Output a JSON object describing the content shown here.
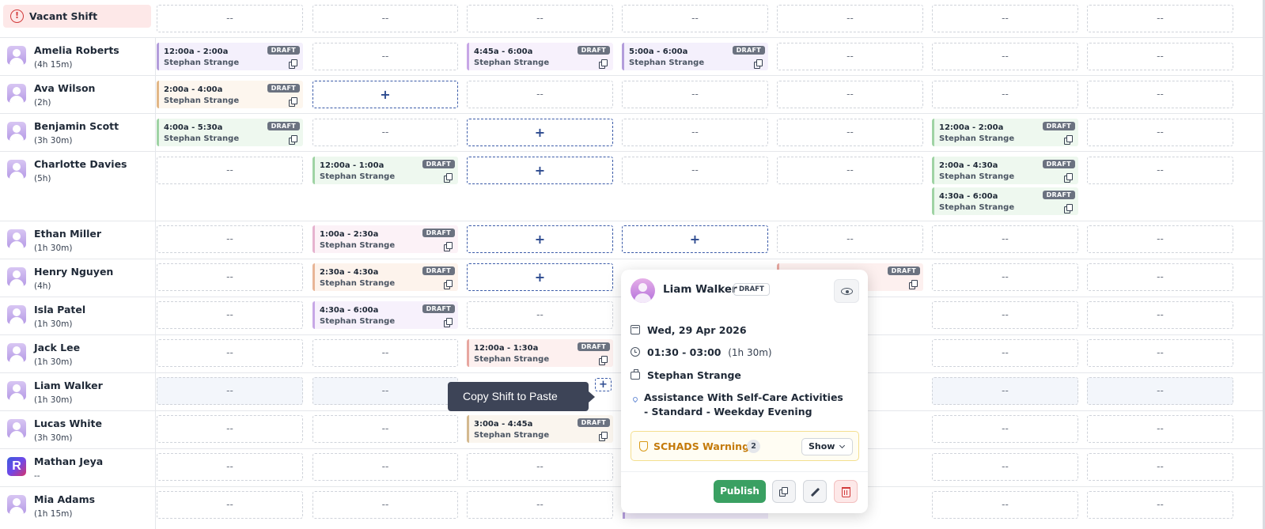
{
  "vacant": {
    "label": "Vacant Shift",
    "empty": [
      "--",
      "--",
      "--",
      "--",
      "--",
      "--",
      "--"
    ]
  },
  "employees": [
    {
      "name": "Amelia Roberts",
      "hours": "(4h 15m)"
    },
    {
      "name": "Ava Wilson",
      "hours": "(2h)"
    },
    {
      "name": "Benjamin Scott",
      "hours": "(3h 30m)"
    },
    {
      "name": "Charlotte Davies",
      "hours": "(5h)"
    },
    {
      "name": "Ethan Miller",
      "hours": "(1h 30m)"
    },
    {
      "name": "Henry Nguyen",
      "hours": "(4h)"
    },
    {
      "name": "Isla Patel",
      "hours": "(1h 30m)"
    },
    {
      "name": "Jack Lee",
      "hours": "(1h 30m)"
    },
    {
      "name": "Liam Walker",
      "hours": "(1h 30m)"
    },
    {
      "name": "Lucas White",
      "hours": "(3h 30m)"
    },
    {
      "name": "Mathan Jeya",
      "hours": "--",
      "initial": "R"
    },
    {
      "name": "Mia Adams",
      "hours": "(1h 15m)"
    }
  ],
  "placeholders": {
    "empty": "--",
    "add": "+"
  },
  "shifts": [
    {
      "time": "12:00a - 2:00a",
      "worker": "Stephan Strange",
      "status": "DRAFT"
    },
    {
      "time": "4:45a - 6:00a",
      "worker": "Stephan Strange",
      "status": "DRAFT"
    },
    {
      "time": "5:00a - 6:00a",
      "worker": "Stephan Strange",
      "status": "DRAFT"
    },
    {
      "time": "2:00a - 4:00a",
      "worker": "Stephan Strange",
      "status": "DRAFT"
    },
    {
      "time": "4:00a - 5:30a",
      "worker": "Stephan Strange",
      "status": "DRAFT"
    },
    {
      "time": "12:00a - 2:00a",
      "worker": "Stephan Strange",
      "status": "DRAFT"
    },
    {
      "time": "12:00a - 1:00a",
      "worker": "Stephan Strange",
      "status": "DRAFT"
    },
    {
      "time": "2:00a - 4:30a",
      "worker": "Stephan Strange",
      "status": "DRAFT"
    },
    {
      "time": "4:30a - 6:00a",
      "worker": "Stephan Strange",
      "status": "DRAFT"
    },
    {
      "time": "1:00a - 2:30a",
      "worker": "Stephan Strange",
      "status": "DRAFT"
    },
    {
      "time": "2:30a - 4:30a",
      "worker": "Stephan Strange",
      "status": "DRAFT"
    },
    {
      "time": "4:30a - 6:00a",
      "worker": "Stephan Strange",
      "status": "DRAFT"
    },
    {
      "time": "12:00a - 1:30a",
      "worker": "Stephan Strange",
      "status": "DRAFT"
    },
    {
      "time": "3:00a - 4:45a",
      "worker": "Stephan Strange",
      "status": "DRAFT"
    },
    {
      "time": "",
      "worker": "",
      "status": "DRAFT"
    }
  ],
  "tooltip": {
    "text": "Copy Shift to Paste"
  },
  "popover": {
    "name": "Liam Walker",
    "status": "DRAFT",
    "date": "Wed, 29 Apr 2026",
    "time": "01:30 - 03:00",
    "duration": "(1h 30m)",
    "worker": "Stephan Strange",
    "location": "Assistance With Self-Care Activities - Standard - Weekday Evening",
    "warnings_label": "SCHADS Warnings",
    "warnings_count": "2",
    "show_label": "Show",
    "publish_label": "Publish"
  },
  "colors": {
    "publish": "#3aa062",
    "warning": "#c47a0a",
    "vacant_bg": "#fde8e8",
    "add_border": "#3b5ba8"
  },
  "icons": [
    "alert-circle-icon",
    "user-avatar-icon",
    "copy-icon",
    "plus-icon",
    "eye-icon",
    "calendar-icon",
    "clock-icon",
    "briefcase-icon",
    "map-pin-icon",
    "shield-icon",
    "chevron-down-icon",
    "pencil-icon",
    "trash-icon"
  ]
}
